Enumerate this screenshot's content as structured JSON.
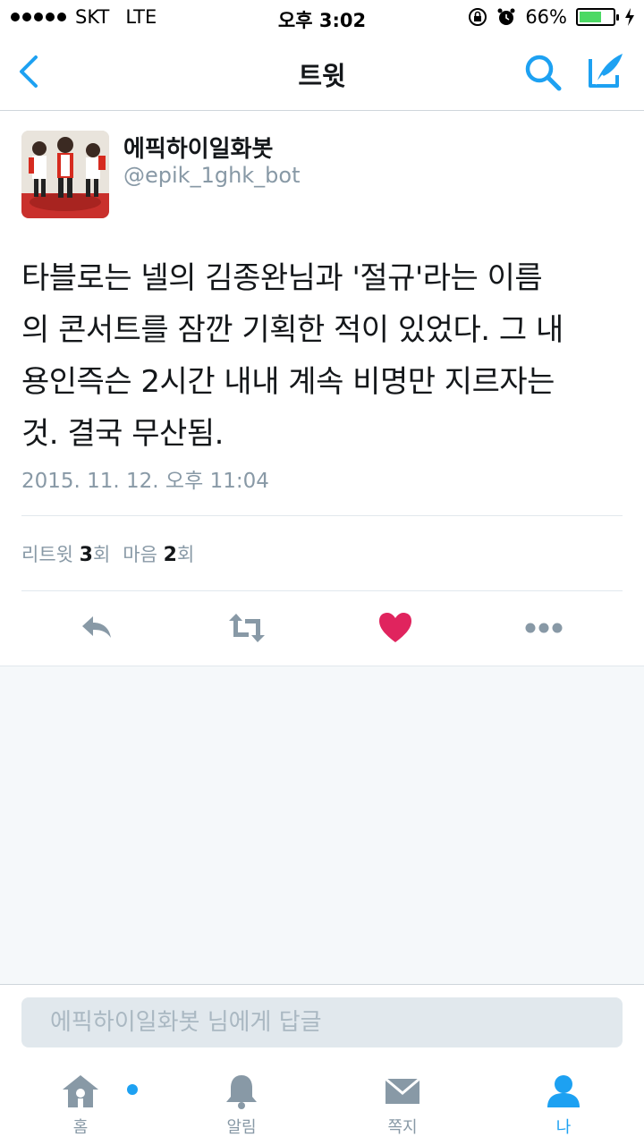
{
  "status_bar": {
    "carrier": "SKT",
    "network": "LTE",
    "time": "오후 3:02",
    "battery": "66%",
    "battery_level": 0.66
  },
  "nav": {
    "title": "트윗"
  },
  "tweet": {
    "author_name": "에픽하이일화봇",
    "author_handle": "@epik_1ghk_bot",
    "lines": [
      "타블로는 넬의 김종완님과 '절규'라는 이름",
      "의 콘서트를 잠깐 기획한 적이 있었다. 그 내",
      "용인즉슨 2시간 내내 계속 비명만 지르자는",
      "것. 결국 무산됨."
    ],
    "timestamp": "2015. 11. 12. 오후 11:04",
    "retweet_label": "리트윗",
    "retweet_count": "3",
    "retweet_unit": "회",
    "like_label": "마음",
    "like_count": "2",
    "like_unit": "회"
  },
  "reply": {
    "placeholder": "에픽하이일화봇 님에게 답글"
  },
  "tabs": [
    {
      "label": "홈",
      "icon": "home-icon"
    },
    {
      "label": "알림",
      "icon": "bell-icon"
    },
    {
      "label": "쪽지",
      "icon": "envelope-icon"
    },
    {
      "label": "나",
      "icon": "person-icon"
    }
  ],
  "colors": {
    "accent": "#1da1f2",
    "like": "#e0245e",
    "muted": "#8899a6"
  }
}
